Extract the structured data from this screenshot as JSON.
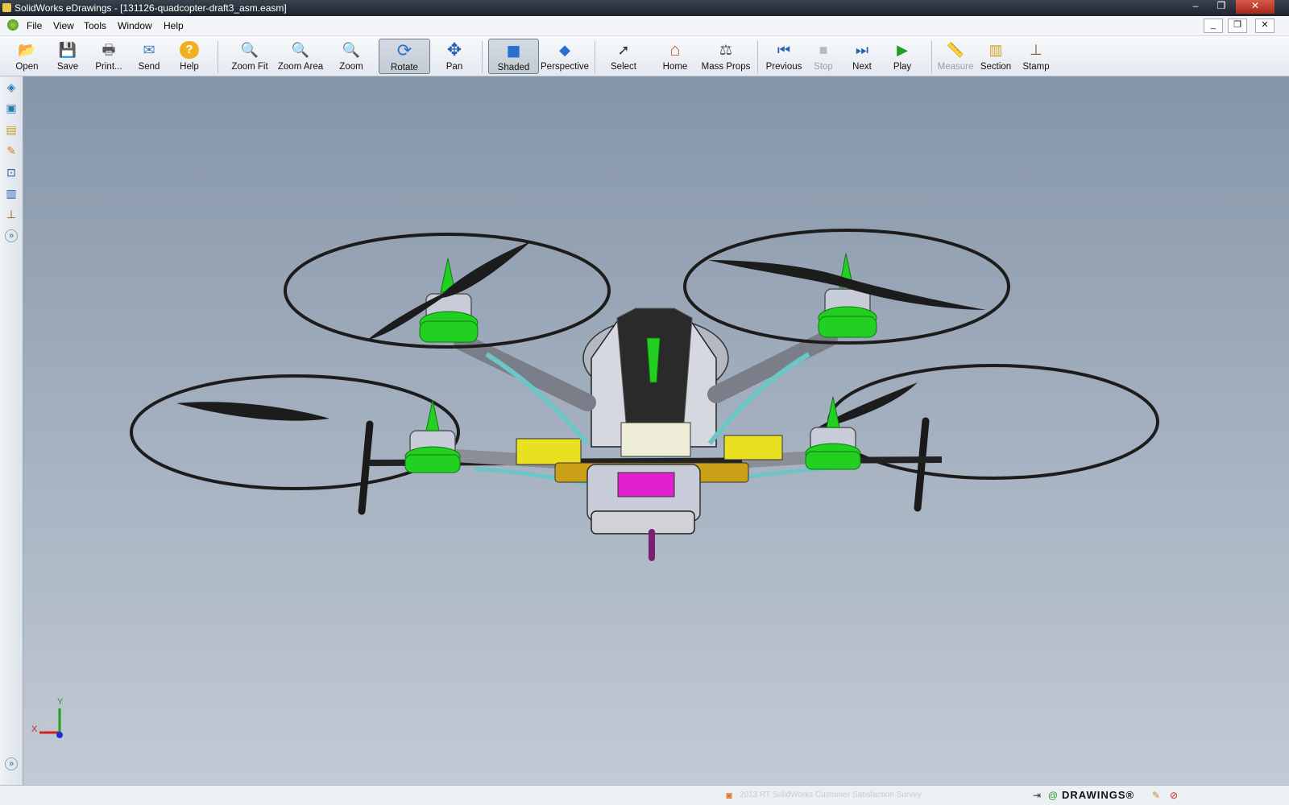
{
  "window": {
    "title": "SolidWorks eDrawings - [131126-quadcopter-draft3_asm.easm]",
    "minimize": "–",
    "restore": "❐",
    "close": "✕"
  },
  "menu": [
    "File",
    "View",
    "Tools",
    "Window",
    "Help"
  ],
  "mdi": {
    "minimize": "_",
    "restore": "❐",
    "close": "✕"
  },
  "toolbar": [
    {
      "label": "Open",
      "icon": "open-folder-icon",
      "glyph": "📂",
      "pressed": false,
      "disabled": false
    },
    {
      "label": "Save",
      "icon": "save-icon",
      "glyph": "💾",
      "pressed": false,
      "disabled": false
    },
    {
      "label": "Print...",
      "icon": "print-icon",
      "glyph": "🖶",
      "pressed": false,
      "disabled": false
    },
    {
      "label": "Send",
      "icon": "send-icon",
      "glyph": "✉",
      "pressed": false,
      "disabled": false
    },
    {
      "label": "Help",
      "icon": "help-icon",
      "glyph": "?",
      "pressed": false,
      "disabled": false
    },
    {
      "label": "Zoom Fit",
      "icon": "zoom-fit-icon",
      "glyph": "🔍",
      "pressed": false,
      "disabled": false
    },
    {
      "label": "Zoom Area",
      "icon": "zoom-area-icon",
      "glyph": "🔍",
      "pressed": false,
      "disabled": false
    },
    {
      "label": "Zoom",
      "icon": "zoom-icon",
      "glyph": "🔍",
      "pressed": false,
      "disabled": false
    },
    {
      "label": "Rotate",
      "icon": "rotate-icon",
      "glyph": "⟳",
      "pressed": true,
      "disabled": false
    },
    {
      "label": "Pan",
      "icon": "pan-icon",
      "glyph": "✥",
      "pressed": false,
      "disabled": false
    },
    {
      "label": "Shaded",
      "icon": "shaded-cube-icon",
      "glyph": "◼",
      "pressed": true,
      "disabled": false
    },
    {
      "label": "Perspective",
      "icon": "perspective-icon",
      "glyph": "◆",
      "pressed": false,
      "disabled": false
    },
    {
      "label": "Select",
      "icon": "select-arrow-icon",
      "glyph": "➚",
      "pressed": false,
      "disabled": false
    },
    {
      "label": "Home",
      "icon": "home-icon",
      "glyph": "⌂",
      "pressed": false,
      "disabled": false
    },
    {
      "label": "Mass Props",
      "icon": "scale-icon",
      "glyph": "⚖",
      "pressed": false,
      "disabled": false
    },
    {
      "label": "Previous",
      "icon": "previous-icon",
      "glyph": "⏮",
      "pressed": false,
      "disabled": false
    },
    {
      "label": "Stop",
      "icon": "stop-icon",
      "glyph": "■",
      "pressed": false,
      "disabled": true
    },
    {
      "label": "Next",
      "icon": "next-icon",
      "glyph": "⏭",
      "pressed": false,
      "disabled": false
    },
    {
      "label": "Play",
      "icon": "play-icon",
      "glyph": "▶",
      "pressed": false,
      "disabled": false
    },
    {
      "label": "Measure",
      "icon": "measure-icon",
      "glyph": "📏",
      "pressed": false,
      "disabled": true
    },
    {
      "label": "Section",
      "icon": "section-icon",
      "glyph": "▥",
      "pressed": false,
      "disabled": false
    },
    {
      "label": "Stamp",
      "icon": "stamp-icon",
      "glyph": "⊥",
      "pressed": false,
      "disabled": false
    }
  ],
  "left_toolbar": [
    {
      "icon": "components-icon",
      "glyph": "◈"
    },
    {
      "icon": "configurations-icon",
      "glyph": "▣"
    },
    {
      "icon": "sheets-icon",
      "glyph": "▤"
    },
    {
      "icon": "markup-icon",
      "glyph": "✎"
    },
    {
      "icon": "measure-tool-icon",
      "glyph": "⊡"
    },
    {
      "icon": "section-tool-icon",
      "glyph": "▥"
    },
    {
      "icon": "stamp-tool-icon",
      "glyph": "⊥"
    },
    {
      "icon": "expand-icon",
      "glyph": "»"
    }
  ],
  "triad": {
    "x": "X",
    "y": "Y"
  },
  "status": {
    "brand": "DRAWINGS®",
    "survey": "2013 RT SolidWorks Customer Satisfaction Survey",
    "expand": "»"
  },
  "colors": {
    "body_green": "#22d022",
    "motor_silver": "#c8ccd8",
    "arm_gray": "#8a8e96",
    "tube_teal": "#6cc6c6",
    "accent_yellow": "#e8e020",
    "battery_magenta": "#e020d0",
    "prop_black": "#1c1c1c"
  }
}
